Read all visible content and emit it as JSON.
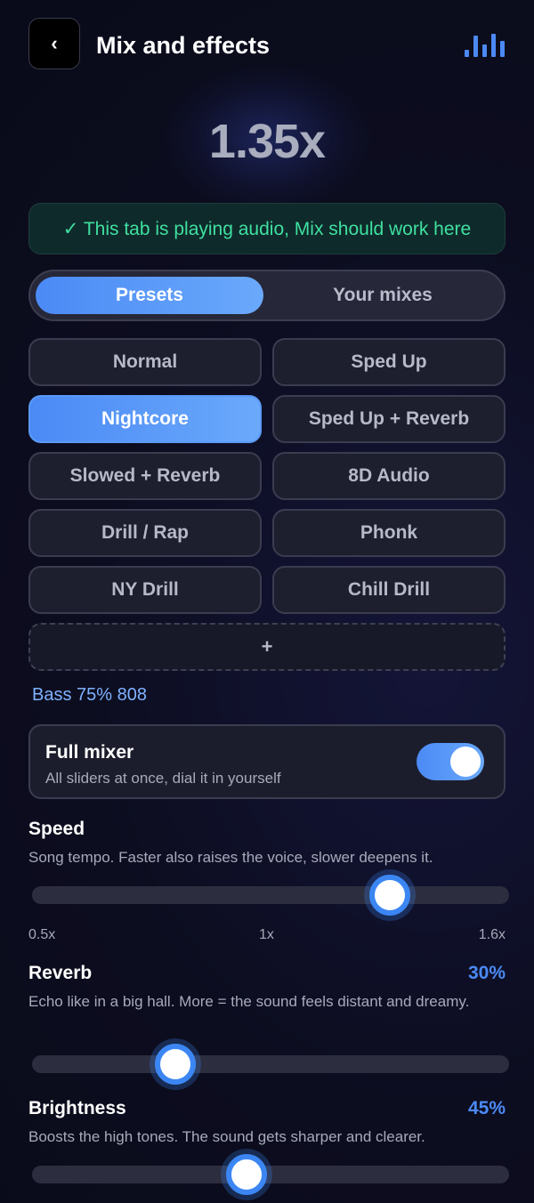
{
  "header": {
    "back_label": "‹",
    "title": "Mix and effects",
    "equalizer_icon": "equalizer-bars-icon"
  },
  "speed_readout": "1.35x",
  "status_banner": "✓ This tab is playing audio, Mix should work here",
  "tabs": [
    {
      "label": "Presets",
      "active": true
    },
    {
      "label": "Your mixes",
      "active": false
    }
  ],
  "presets": [
    {
      "label": "Normal",
      "active": false
    },
    {
      "label": "Sped Up",
      "active": false
    },
    {
      "label": "Nightcore",
      "active": true
    },
    {
      "label": "Sped Up + Reverb",
      "active": false
    },
    {
      "label": "Slowed + Reverb",
      "active": false
    },
    {
      "label": "8D Audio",
      "active": false
    },
    {
      "label": "Drill / Rap",
      "active": false
    },
    {
      "label": "Phonk",
      "active": false
    },
    {
      "label": "NY Drill",
      "active": false
    },
    {
      "label": "Chill Drill",
      "active": false
    }
  ],
  "add_preset_label": "+",
  "preset_summary": "Bass 75% 808",
  "full_mixer": {
    "title": "Full mixer",
    "subtitle": "All sliders at once, dial it in yourself",
    "enabled": true
  },
  "speed": {
    "label": "Speed",
    "description": "Song tempo. Faster also raises the voice, slower deepens it.",
    "min_label": "0.5x",
    "mid_label": "1x",
    "max_label": "1.6x",
    "level": 0.75
  },
  "reverb": {
    "label": "Reverb",
    "value": "30%",
    "description": "Echo like in a big hall. More = the sound feels distant and dreamy.",
    "level": 0.3
  },
  "brightness": {
    "label": "Brightness",
    "value": "45%",
    "description": "Boosts the high tones. The sound gets sharper and clearer.",
    "level": 0.45
  },
  "colors": {
    "accent": "#4b8af5",
    "success": "#3ee0a0",
    "background": "#0c0d1f"
  }
}
